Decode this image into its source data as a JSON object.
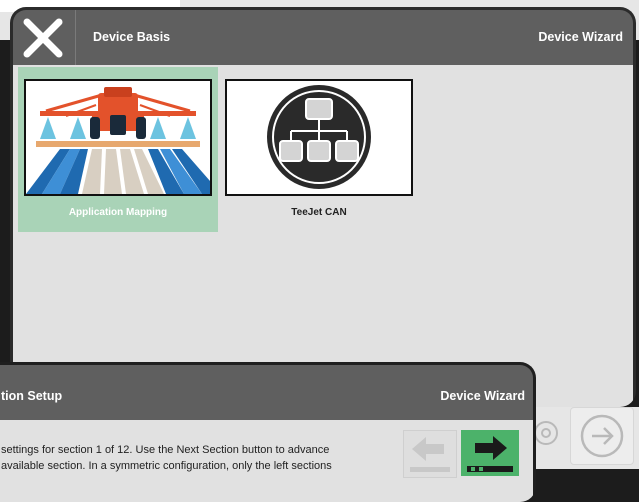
{
  "window_main": {
    "title": "Device Basis",
    "subtitle": "Device Wizard",
    "tiles": [
      {
        "label": "Application Mapping",
        "selected": true,
        "icon": "sprayer-field-icon"
      },
      {
        "label": "TeeJet CAN",
        "selected": false,
        "icon": "network-hierarchy-icon"
      }
    ]
  },
  "window_second": {
    "title": "tion Setup",
    "subtitle": "Device Wizard",
    "description": "settings for section 1 of 12. Use the Next Section button to advance\navailable section. In a symmetric configuration, only the left sections",
    "prev_icon": "arrow-left-icon",
    "next_icon": "arrow-right-icon"
  },
  "colors": {
    "titlebar": "#5f5f5f",
    "selected_tile": "#a9d3b7",
    "next_button": "#4cb26a",
    "content_bg": "#e1e1e1"
  }
}
